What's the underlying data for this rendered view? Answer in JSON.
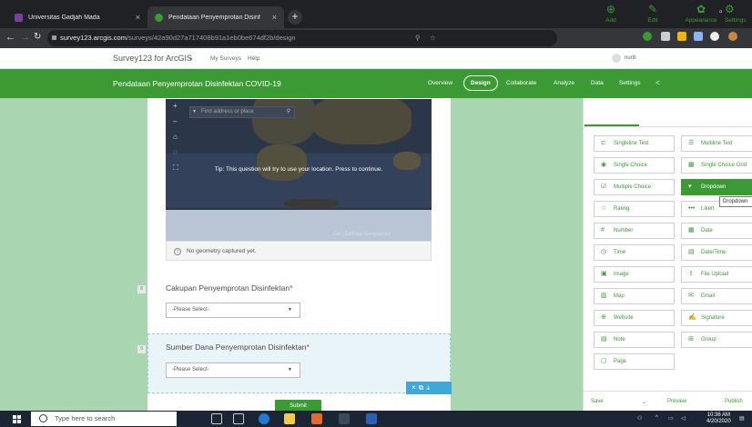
{
  "browser": {
    "tabs": [
      {
        "label": "Universitas Gadjah Mada",
        "favicon_color": "#7b3fa0"
      },
      {
        "label": "Pendataan Penyemprotan Disinf",
        "favicon_color": "#3b9a34"
      }
    ],
    "new_tab": "+",
    "url_host": "survey123.arcgis.com",
    "url_path": "/surveys/42a90d27a717408b91a1eb0be674df2b/design"
  },
  "app": {
    "brand": "Survey123 for ArcGIS",
    "menu": [
      "My Surveys",
      "Help"
    ],
    "user": "nurlil"
  },
  "survey": {
    "title": "Pendataan Penyemprotan Disinfektan COVID-19",
    "nav": [
      "Overview",
      "Design",
      "Collaborate",
      "Analyze",
      "Data",
      "Settings"
    ],
    "active_nav": "Design"
  },
  "form": {
    "map": {
      "search_placeholder": "Find address or place",
      "tip": "Tip: This question will try to use your location. Press to continue.",
      "attribution": "Esri | Earthstar Geographics",
      "no_geometry": "No geometry captured yet."
    },
    "questions": [
      {
        "number": "8",
        "label": "Cakupan Penyemprotan Disinfektan",
        "required": "*",
        "placeholder": "-Please Select-"
      },
      {
        "number": "9",
        "label": "Sumber Dana Penyemprotan Disinfektan",
        "required": "*",
        "placeholder": "-Please Select-"
      }
    ],
    "submit": "Submit"
  },
  "panel": {
    "tabs": [
      {
        "label": "Add",
        "icon": "plus-circle-icon"
      },
      {
        "label": "Edit",
        "icon": "pencil-icon"
      },
      {
        "label": "Appearance",
        "icon": "palette-icon"
      },
      {
        "label": "Settings",
        "icon": "settings-icon"
      }
    ],
    "question_types": [
      {
        "label": "Singleline Text",
        "icon": "singleline-icon"
      },
      {
        "label": "Multiline Text",
        "icon": "multiline-icon"
      },
      {
        "label": "Single Choice",
        "icon": "radio-icon"
      },
      {
        "label": "Single Choice Grid",
        "icon": "grid-icon"
      },
      {
        "label": "Multiple Choice",
        "icon": "checkbox-icon"
      },
      {
        "label": "Dropdown",
        "icon": "dropdown-icon",
        "active": true
      },
      {
        "label": "Rating",
        "icon": "star-icon"
      },
      {
        "label": "Likert",
        "icon": "likert-icon"
      },
      {
        "label": "Number",
        "icon": "number-icon"
      },
      {
        "label": "Date",
        "icon": "calendar-icon"
      },
      {
        "label": "Time",
        "icon": "clock-icon"
      },
      {
        "label": "Date/Time",
        "icon": "datetime-icon"
      },
      {
        "label": "Image",
        "icon": "image-icon"
      },
      {
        "label": "File Upload",
        "icon": "upload-icon"
      },
      {
        "label": "Map",
        "icon": "map-icon"
      },
      {
        "label": "Email",
        "icon": "email-icon"
      },
      {
        "label": "Website",
        "icon": "globe-icon"
      },
      {
        "label": "Signature",
        "icon": "signature-icon"
      },
      {
        "label": "Note",
        "icon": "note-icon"
      },
      {
        "label": "Group",
        "icon": "group-icon"
      },
      {
        "label": "Page",
        "icon": "page-icon"
      }
    ],
    "tooltip": "Dropdown",
    "footer": {
      "save": "Save",
      "preview": "Preview",
      "publish": "Publish"
    }
  },
  "taskbar": {
    "search_placeholder": "Type here to search",
    "time": "10:36 AM",
    "date": "4/20/2020"
  },
  "colors": {
    "accent": "#3b9a34",
    "canvas": "#a9d5b0",
    "selection": "#3fa8d8"
  }
}
